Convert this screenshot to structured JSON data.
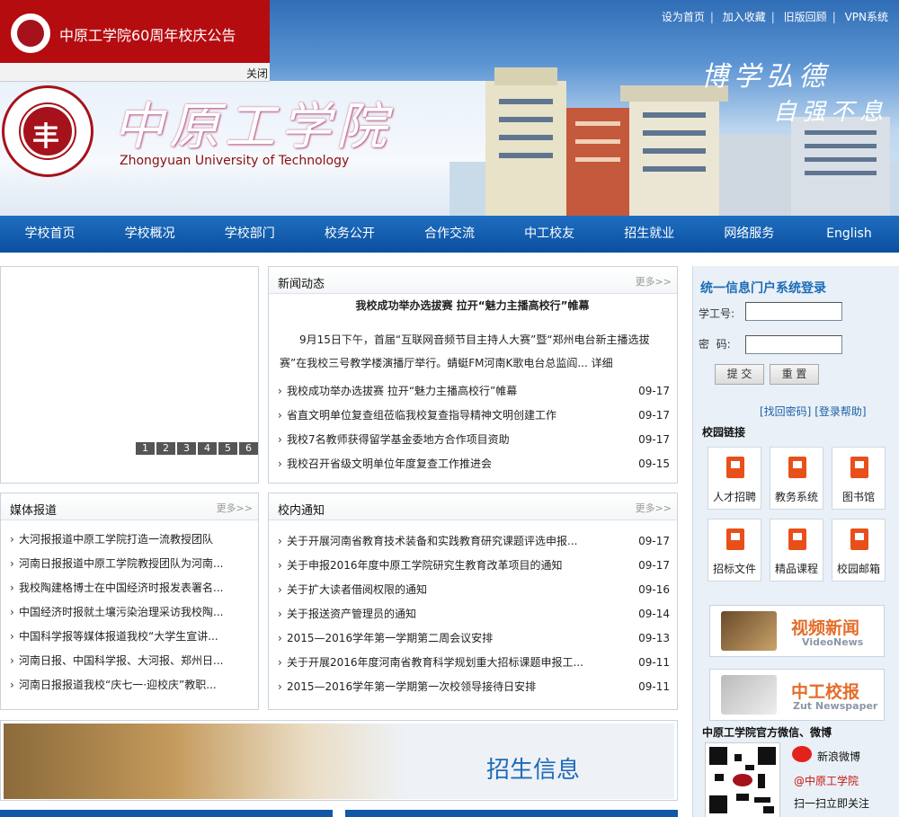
{
  "header": {
    "top_links": [
      "设为首页",
      "加入收藏",
      "旧版回顾",
      "VPN系统"
    ],
    "banner_title": "中原工学院60周年校庆公告",
    "banner_close": "关闭",
    "logo_cn": "中原工学院",
    "logo_en": "Zhongyuan University of Technology",
    "slogan_line1": "博学弘德",
    "slogan_line2": "自强不息"
  },
  "nav": [
    "学校首页",
    "学校概况",
    "学校部门",
    "校务公开",
    "合作交流",
    "中工校友",
    "招生就业",
    "网络服务",
    "English"
  ],
  "slider": {
    "pages": [
      "1",
      "2",
      "3",
      "4",
      "5",
      "6"
    ]
  },
  "news": {
    "title": "新闻动态",
    "more": "更多>>",
    "headline": "我校成功举办选拔赛 拉开“魅力主播高校行”帷幕",
    "summary": "9月15日下午，首届“互联网音频节目主持人大赛”暨“郑州电台新主播选拔赛”在我校三号教学楼演播厅举行。蜻蜓FM河南K歌电台总监阎... 详细",
    "items": [
      {
        "title": "我校成功举办选拔赛 拉开“魅力主播高校行”帷幕",
        "date": "09-17"
      },
      {
        "title": "省直文明单位复查组莅临我校复查指导精神文明创建工作",
        "date": "09-17"
      },
      {
        "title": "我校7名教师获得留学基金委地方合作项目资助",
        "date": "09-17"
      },
      {
        "title": "我校召开省级文明单位年度复查工作推进会",
        "date": "09-15"
      }
    ]
  },
  "media": {
    "title": "媒体报道",
    "more": "更多>>",
    "items": [
      "大河报报道中原工学院打造一流教授团队",
      "河南日报报道中原工学院教授团队为河南...",
      "我校陶建格博士在中国经济时报发表署名...",
      "中国经济时报就土壤污染治理采访我校陶...",
      "中国科学报等媒体报道我校“大学生宣讲...",
      "河南日报、中国科学报、大河报、郑州日...",
      "河南日报报道我校“庆七一·迎校庆”教职..."
    ]
  },
  "notices": {
    "title": "校内通知",
    "more": "更多>>",
    "items": [
      {
        "title": "关于开展河南省教育技术装备和实践教育研究课题评选申报...",
        "date": "09-17"
      },
      {
        "title": "关于申报2016年度中原工学院研究生教育改革项目的通知",
        "date": "09-17"
      },
      {
        "title": "关于扩大读者借阅权限的通知",
        "date": "09-16"
      },
      {
        "title": "关于报送资产管理员的通知",
        "date": "09-14"
      },
      {
        "title": "2015—2016学年第一学期第二周会议安排",
        "date": "09-13"
      },
      {
        "title": "关于开展2016年度河南省教育科学规划重大招标课题申报工...",
        "date": "09-11"
      },
      {
        "title": "2015—2016学年第一学期第一次校领导接待日安排",
        "date": "09-11"
      }
    ]
  },
  "login": {
    "title": "统一信息门户系统登录",
    "user_label": "学工号:",
    "pass_label": "密  码:",
    "submit": "提 交",
    "reset": "重 置",
    "forgot": "[找回密码]",
    "help": "[登录帮助]"
  },
  "campus_links": {
    "title": "校园链接",
    "items": [
      "人才招聘",
      "教务系统",
      "图书馆",
      "招标文件",
      "精品课程",
      "校园邮箱"
    ]
  },
  "banners": [
    {
      "title": "视频新闻",
      "sub": "VideoNews"
    },
    {
      "title": "中工校报",
      "sub": "Zut Newspaper"
    }
  ],
  "social": {
    "title": "中原工学院官方微信、微博",
    "weibo": "新浪微博",
    "account": "@中原工学院",
    "scan": "扫一扫立即关注"
  },
  "enroll": {
    "title": "招生信息"
  }
}
